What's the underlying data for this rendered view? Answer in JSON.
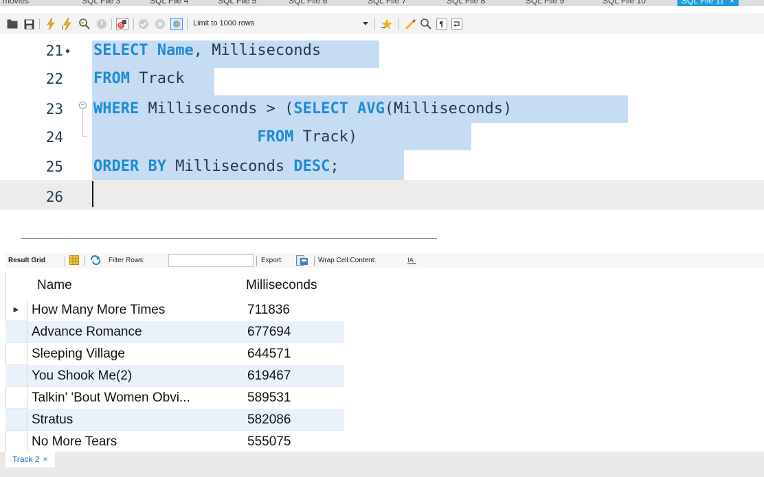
{
  "top_tabs": [
    {
      "label": "movies"
    },
    {
      "label": "SQL File 3"
    },
    {
      "label": "SQL File 4"
    },
    {
      "label": "SQL File 5"
    },
    {
      "label": "SQL File 6"
    },
    {
      "label": "SQL File 7"
    },
    {
      "label": "SQL File 8"
    },
    {
      "label": "SQL File 9"
    },
    {
      "label": "SQL File 10"
    },
    {
      "label": "SQL File 11",
      "close": "×"
    }
  ],
  "toolbar": {
    "limit_label": "Limit to 1000 rows",
    "icons": [
      "folder-icon",
      "save-icon",
      "execute-icon",
      "execute-current-icon",
      "explain-icon",
      "stop-icon",
      "toggle-error-icon",
      "commit-icon",
      "rollback-icon",
      "autocommit-icon",
      "dropdown-icon",
      "beautify-icon",
      "brush-icon",
      "find-icon",
      "invisible-chars-icon",
      "wrap-icon"
    ]
  },
  "editor": {
    "line_numbers": [
      "21",
      "22",
      "23",
      "24",
      "25",
      "26"
    ],
    "lines": [
      {
        "parts": [
          {
            "t": "SELECT ",
            "k": true
          },
          {
            "t": "Name",
            "k": true
          },
          {
            "t": ", Milliseconds",
            "k": false
          }
        ]
      },
      {
        "parts": [
          {
            "t": "FROM",
            "k": true
          },
          {
            "t": " Track",
            "k": false
          }
        ]
      },
      {
        "parts": [
          {
            "t": "WHERE",
            "k": true
          },
          {
            "t": " Milliseconds > (",
            "k": false
          },
          {
            "t": "SELECT AVG",
            "k": true
          },
          {
            "t": "(Milliseconds)",
            "k": false
          }
        ]
      },
      {
        "parts": [
          {
            "t": "                  ",
            "k": false
          },
          {
            "t": "FROM",
            "k": true
          },
          {
            "t": " Track)",
            "k": false
          }
        ]
      },
      {
        "parts": [
          {
            "t": "ORDER BY",
            "k": true
          },
          {
            "t": " Milliseconds ",
            "k": false
          },
          {
            "t": "DESC",
            "k": true
          },
          {
            "t": ";",
            "k": false
          }
        ]
      },
      {
        "parts": []
      }
    ],
    "colors": {
      "keyword": "#1d8ad6",
      "text": "#1f3c4d",
      "selection": "#c6dcf2"
    }
  },
  "result_toolbar": {
    "result_grid_label": "Result Grid",
    "filter_label": "Filter Rows:",
    "filter_value": "",
    "export_label": "Export:",
    "wrap_label": "Wrap Cell Content:"
  },
  "result_grid": {
    "columns": [
      "Name",
      "Milliseconds"
    ],
    "rows": [
      {
        "name": "How Many More Times",
        "ms": "711836",
        "current": true
      },
      {
        "name": "Advance Romance",
        "ms": "677694"
      },
      {
        "name": "Sleeping Village",
        "ms": "644571"
      },
      {
        "name": "You Shook Me(2)",
        "ms": "619467"
      },
      {
        "name": "Talkin' 'Bout Women Obvi...",
        "ms": "589531"
      },
      {
        "name": "Stratus",
        "ms": "582086"
      },
      {
        "name": "No More Tears",
        "ms": "555075"
      }
    ]
  },
  "bottom_tabs": [
    {
      "label": "Track 2",
      "close": "×"
    }
  ]
}
